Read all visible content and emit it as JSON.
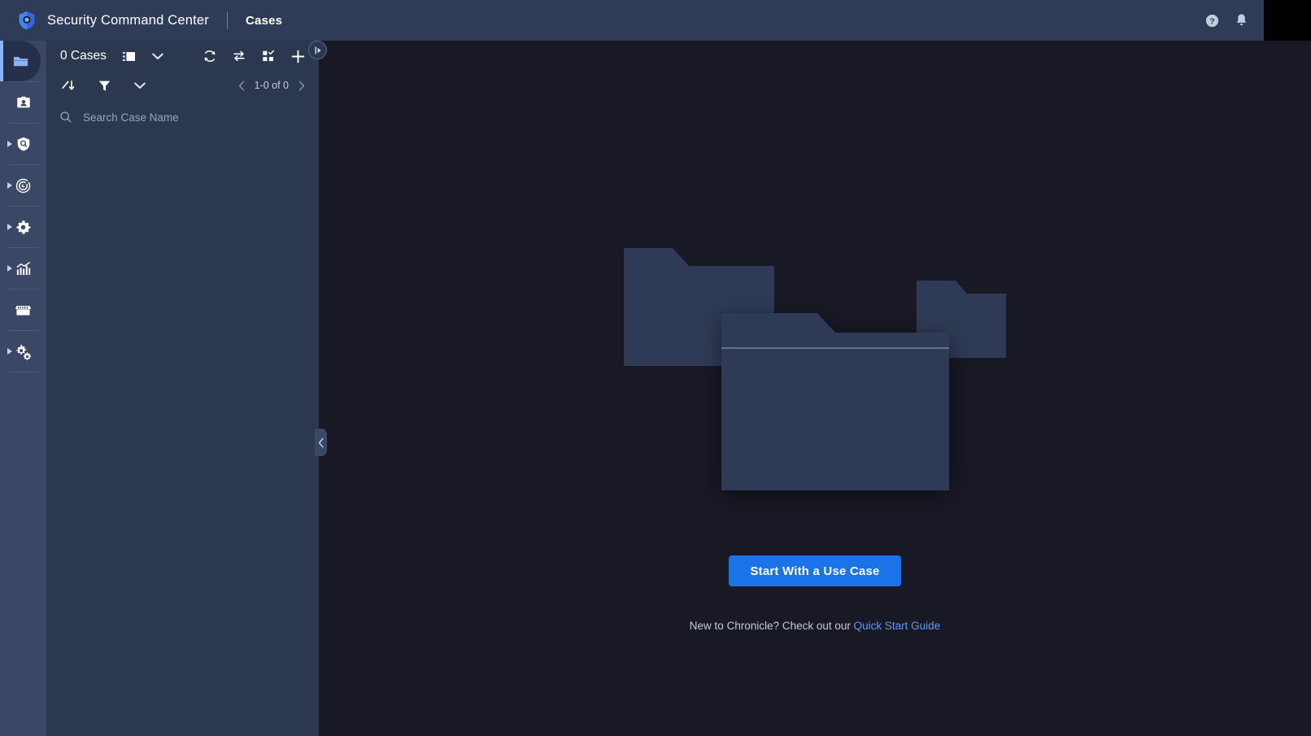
{
  "header": {
    "brand_title": "Security Command Center",
    "section_title": "Cases",
    "logo_icon": "shield-logo-icon",
    "help_icon": "help-circle-icon",
    "notifications_icon": "bell-icon",
    "avatar_label": "avatar"
  },
  "sidebar": {
    "items": [
      {
        "name": "cases",
        "icon": "folder-icon",
        "active": true,
        "expandable": false
      },
      {
        "name": "my-cases",
        "icon": "id-badge-icon",
        "active": false,
        "expandable": false
      },
      {
        "name": "investigate",
        "icon": "shield-search-icon",
        "active": false,
        "expandable": true
      },
      {
        "name": "detection",
        "icon": "radar-target-icon",
        "active": false,
        "expandable": true
      },
      {
        "name": "settings",
        "icon": "gear-icon",
        "active": false,
        "expandable": true
      },
      {
        "name": "analytics",
        "icon": "bar-chart-icon",
        "active": false,
        "expandable": true
      },
      {
        "name": "marketplace",
        "icon": "storefront-icon",
        "active": false,
        "expandable": false
      },
      {
        "name": "soar-settings",
        "icon": "gears-settings-icon",
        "active": false,
        "expandable": true
      }
    ]
  },
  "cases_panel": {
    "count_label": "0 Cases",
    "view_toggle_icon": "layout-view-icon",
    "view_dropdown_icon": "chevron-down-icon",
    "refresh_icon": "refresh-icon",
    "swap_icon": "swap-arrows-icon",
    "bulk_select_icon": "grid-select-icon",
    "add_icon": "plus-icon",
    "sort_icon": "sort-icon",
    "filter_icon": "filter-funnel-icon",
    "filter_dropdown_icon": "chevron-down-icon",
    "pagination_label": "1-0 of 0",
    "prev_page_icon": "chevron-left-icon",
    "next_page_icon": "chevron-right-icon",
    "search_icon": "search-icon",
    "search_placeholder": "Search Case Name",
    "search_value": "",
    "collapse_handle_icon": "panel-collapse-icon",
    "divider_handle_icon": "chevron-left-icon"
  },
  "main": {
    "illustration": "empty-folders-illustration",
    "cta_label": "Start With a Use Case",
    "helper_prefix": "New to Chronicle? Check out our ",
    "helper_link_label": "Quick Start Guide"
  },
  "colors": {
    "page_bg": "#191926",
    "header_bg": "#2F3C57",
    "rail_bg": "#3A4865",
    "panel_bg": "#2B3850",
    "accent_blue": "#1A73E8",
    "link_blue": "#5B9BF8",
    "active_indicator": "#8AB4F8",
    "folder_fill": "#2E3A55"
  }
}
